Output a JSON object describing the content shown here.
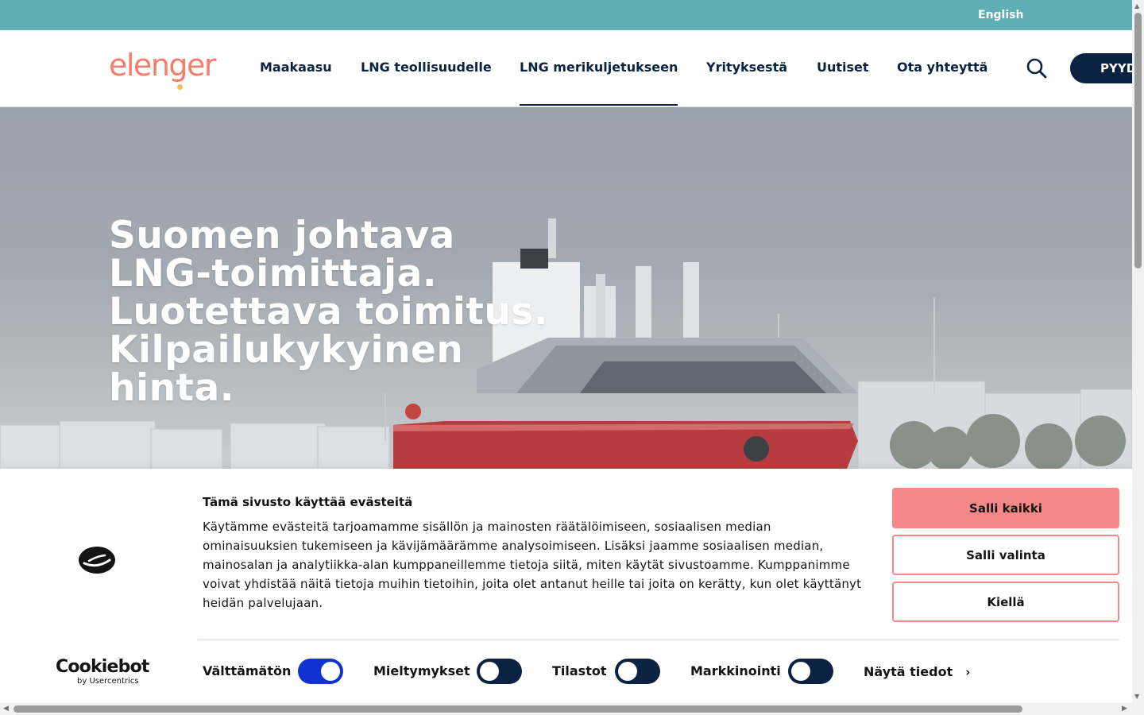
{
  "topbar": {
    "language": "English",
    "background": "#5fafb5"
  },
  "header": {
    "logo_text": "elenger",
    "nav": [
      {
        "label": "Maakaasu",
        "active": false
      },
      {
        "label": "LNG teollisuudelle",
        "active": false
      },
      {
        "label": "LNG merikuljetukseen",
        "active": true
      },
      {
        "label": "Yrityksestä",
        "active": false
      },
      {
        "label": "Uutiset",
        "active": false
      },
      {
        "label": "Ota yhteyttä",
        "active": false
      }
    ],
    "search_icon": "search-icon",
    "cta_label": "PYYD"
  },
  "hero": {
    "headline": [
      "Suomen johtava",
      "LNG-toimittaja.",
      "Luotettava toimitus.",
      "Kilpailukykyinen",
      "hinta."
    ]
  },
  "cookie": {
    "title": "Tämä sivusto käyttää evästeitä",
    "body": "Käytämme evästeitä tarjoamamme sisällön ja mainosten räätälöimiseen, sosiaalisen median ominaisuuksien tukemiseen ja kävijämäärämme analysoimiseen. Lisäksi jaamme sosiaalisen median, mainosalan ja analytiikka-alan kumppaneillemme tietoja siitä, miten käytät sivustoamme. Kumppanimme voivat yhdistää näitä tietoja muihin tietoihin, joita olet antanut heille tai joita on kerätty, kun olet käyttänyt heidän palvelujaan.",
    "buttons": {
      "allow_all": "Salli kaikki",
      "allow_selection": "Salli valinta",
      "deny": "Kiellä"
    },
    "toggles": [
      {
        "label": "Välttämätön",
        "on": true
      },
      {
        "label": "Mieltymykset",
        "on": false
      },
      {
        "label": "Tilastot",
        "on": false
      },
      {
        "label": "Markkinointi",
        "on": false
      }
    ],
    "show_details": "Näytä tiedot",
    "brand_name": "Cookiebot",
    "brand_by": "by Usercentrics"
  },
  "colors": {
    "navy": "#0b2240",
    "coral": "#f68987",
    "toggle_on": "#1032cf",
    "logo": "#f47e6e"
  }
}
